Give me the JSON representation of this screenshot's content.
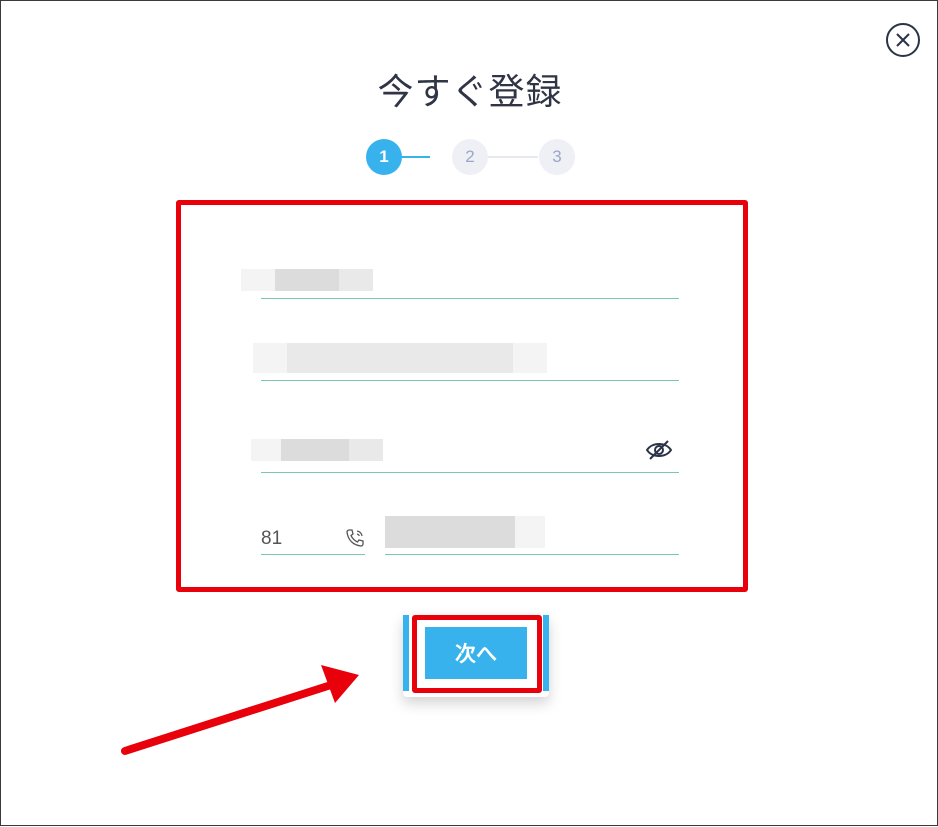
{
  "dialog": {
    "title": "今すぐ登録",
    "close_icon": "close-circle-icon"
  },
  "steps": [
    {
      "label": "1",
      "state": "active"
    },
    {
      "label": "2",
      "state": "inactive"
    },
    {
      "label": "3",
      "state": "inactive"
    }
  ],
  "form": {
    "field_1": {
      "value": ""
    },
    "field_2": {
      "value": ""
    },
    "password": {
      "value": "",
      "visibility_icon": "eye-slash-icon"
    },
    "phone": {
      "country_code": "81",
      "phone_icon": "phone-icon",
      "number": ""
    }
  },
  "actions": {
    "next_label": "次へ"
  },
  "colors": {
    "accent": "#38b2ec",
    "field_underline": "#79c9a8",
    "annotation_red": "#e8000b",
    "title_text": "#2f3545"
  }
}
